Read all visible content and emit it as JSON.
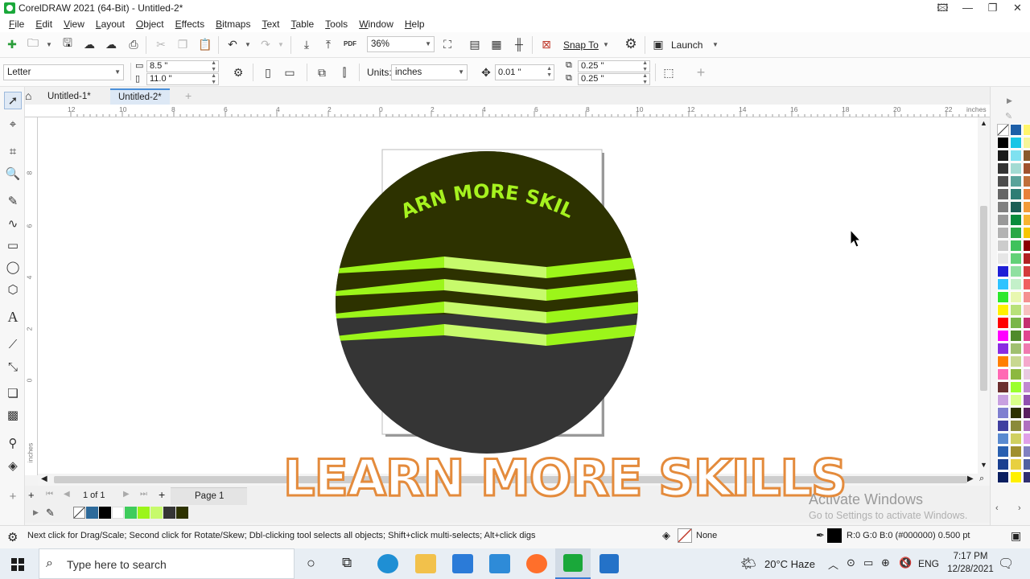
{
  "window": {
    "title": "CorelDRAW 2021 (64-Bit) - Untitled-2*",
    "controls": {
      "profile": "🖾",
      "minimize": "—",
      "restore": "❐",
      "close": "✕"
    }
  },
  "menu": [
    "File",
    "Edit",
    "View",
    "Layout",
    "Object",
    "Effects",
    "Bitmaps",
    "Text",
    "Table",
    "Tools",
    "Window",
    "Help"
  ],
  "standard_toolbar": {
    "zoom_value": "36%",
    "pdf_label": "PDF",
    "snap_to_label": "Snap To",
    "launch_label": "Launch"
  },
  "property_bar": {
    "page_size": "Letter",
    "page_width": "8.5 \"",
    "page_height": "11.0 \"",
    "units_label": "Units:",
    "units_value": "inches",
    "nudge_value": "0.01 \"",
    "duplicate_x": "0.25 \"",
    "duplicate_y": "0.25 \"",
    "add_label": "+"
  },
  "doc_tabs": [
    {
      "label": "Untitled-1*",
      "active": false
    },
    {
      "label": "Untitled-2*",
      "active": true
    }
  ],
  "rulers": {
    "h_numbers": [
      "12",
      "10",
      "8",
      "6",
      "4",
      "2",
      "0",
      "2",
      "4",
      "6",
      "8",
      "10",
      "12",
      "14",
      "16",
      "18",
      "20",
      "22"
    ],
    "h_unit": "inches",
    "v_numbers": [
      "8",
      "6",
      "4",
      "2",
      "0"
    ],
    "v_unit": "inches"
  },
  "artwork": {
    "arc_text": "LEARN MORE SKILLS",
    "circle_top_color": "#2d3200",
    "circle_bottom_color": "#353535",
    "stripe_bright": "#9cf51a",
    "stripe_light": "#c7fa6c",
    "arc_text_color": "#a6f21f"
  },
  "overlay": {
    "text": "LEARN MORE SKILLS",
    "stroke_color": "#e48b3c"
  },
  "page_nav": {
    "counter": "1 of 1",
    "page_tab": "Page 1"
  },
  "watermark": {
    "line1": "Activate Windows",
    "line2": "Go to Settings to activate Windows."
  },
  "status": {
    "hint": "Next click for Drag/Scale; Second click for Rotate/Skew; Dbl-clicking tool selects all objects; Shift+click multi-selects; Alt+click digs",
    "fill_label": "None",
    "outline_info": "R:0 G:0 B:0 (#000000)  0.500 pt"
  },
  "taskbar": {
    "search_placeholder": "Type here to search",
    "weather": "20°C  Haze",
    "language": "ENG",
    "time": "7:17 PM",
    "date": "12/28/2021"
  },
  "palette_colors": [
    [
      "#ffffff",
      "#1d5fa8",
      "#fff56b"
    ],
    [
      "#000000",
      "#18c5e6",
      "#f5f59a"
    ],
    [
      "#1a1a1a",
      "#7fe1f0",
      "#8a5a2b"
    ],
    [
      "#333333",
      "#a3dbd3",
      "#a0522d"
    ],
    [
      "#4d4d4d",
      "#5aa39a",
      "#c0703a"
    ],
    [
      "#666666",
      "#2e7d74",
      "#e8813a"
    ],
    [
      "#808080",
      "#1b5e55",
      "#f29b38"
    ],
    [
      "#999999",
      "#0a8c3c",
      "#f6b431"
    ],
    [
      "#b3b3b3",
      "#2aa845",
      "#f7c600"
    ],
    [
      "#cccccc",
      "#3fc25c",
      "#8b0000"
    ],
    [
      "#e6e6e6",
      "#62d177",
      "#b22222"
    ],
    [
      "#1f1fd6",
      "#90e0a0",
      "#d43b3b"
    ],
    [
      "#2ec3ff",
      "#c3f0c9",
      "#f06060"
    ],
    [
      "#2ce82c",
      "#e8f7b0",
      "#f59090"
    ],
    [
      "#fff000",
      "#b8e17a",
      "#f7c0c0"
    ],
    [
      "#ff0000",
      "#7ab648",
      "#c43070"
    ],
    [
      "#ff00ff",
      "#4f8a2a",
      "#e04590"
    ],
    [
      "#8a2be2",
      "#a0c070",
      "#f07ab0"
    ],
    [
      "#ff7f00",
      "#c8d890",
      "#f5a8cc"
    ],
    [
      "#ff69b4",
      "#8db840",
      "#e8c8e0"
    ],
    [
      "#6b2f2f",
      "#9bff2e",
      "#c08ad0"
    ],
    [
      "#c8a0e0",
      "#d9ff8a",
      "#9050b0"
    ],
    [
      "#7f7fd0",
      "#2d3200",
      "#5a2060"
    ],
    [
      "#4040a0",
      "#8b8b3a",
      "#b070c0"
    ],
    [
      "#5a8ad0",
      "#d0d060",
      "#e0a0e8"
    ],
    [
      "#2a60b0",
      "#a09030",
      "#8080c0"
    ],
    [
      "#1a3f90",
      "#e8d040",
      "#5060a0"
    ],
    [
      "#0a1f60",
      "#fff000",
      "#303070"
    ]
  ]
}
